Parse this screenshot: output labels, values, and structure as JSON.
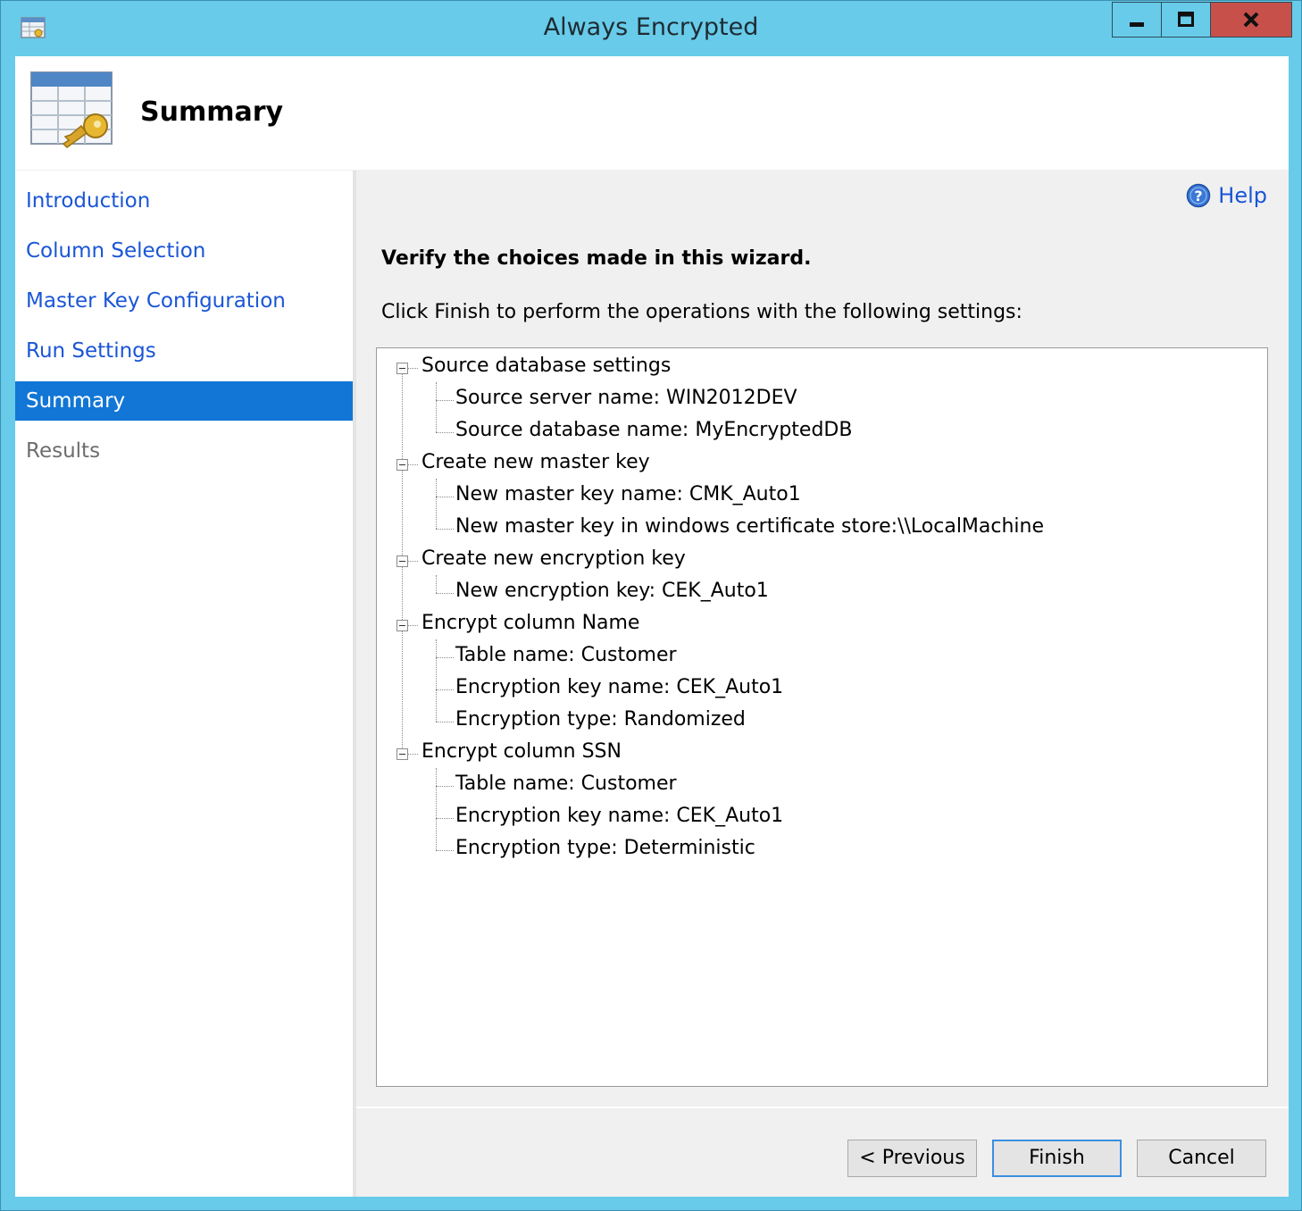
{
  "window": {
    "title": "Always Encrypted",
    "icons": {
      "app": "wizard-icon",
      "minimize": "minimize-icon",
      "maximize": "maximize-icon",
      "close": "close-icon"
    }
  },
  "header": {
    "title": "Summary",
    "icon": "table-key-icon"
  },
  "sidebar": {
    "items": [
      {
        "label": "Introduction",
        "state": "link"
      },
      {
        "label": "Column Selection",
        "state": "link"
      },
      {
        "label": "Master Key Configuration",
        "state": "link"
      },
      {
        "label": "Run Settings",
        "state": "link"
      },
      {
        "label": "Summary",
        "state": "selected"
      },
      {
        "label": "Results",
        "state": "disabled"
      }
    ]
  },
  "content": {
    "help_label": "Help",
    "verify_heading": "Verify the choices made in this wizard.",
    "instructions": "Click Finish to perform the operations with the following settings:"
  },
  "tree": [
    {
      "label": "Source database settings",
      "children": [
        "Source server name: WIN2012DEV",
        "Source database name: MyEncryptedDB"
      ]
    },
    {
      "label": "Create new master key",
      "children": [
        "New master key name: CMK_Auto1",
        "New master key in windows certificate store:\\\\LocalMachine"
      ]
    },
    {
      "label": "Create new encryption key",
      "children": [
        "New encryption key: CEK_Auto1"
      ]
    },
    {
      "label": "Encrypt column Name",
      "children": [
        "Table name: Customer",
        "Encryption key name: CEK_Auto1",
        "Encryption type: Randomized"
      ]
    },
    {
      "label": "Encrypt column SSN",
      "children": [
        "Table name: Customer",
        "Encryption key name: CEK_Auto1",
        "Encryption type: Deterministic"
      ]
    }
  ],
  "buttons": {
    "previous": "< Previous",
    "finish": "Finish",
    "cancel": "Cancel"
  },
  "colors": {
    "title_bar": "#68cbe9",
    "close_button": "#c7504a",
    "link": "#1a56d6",
    "selected_nav": "#1176d6"
  }
}
